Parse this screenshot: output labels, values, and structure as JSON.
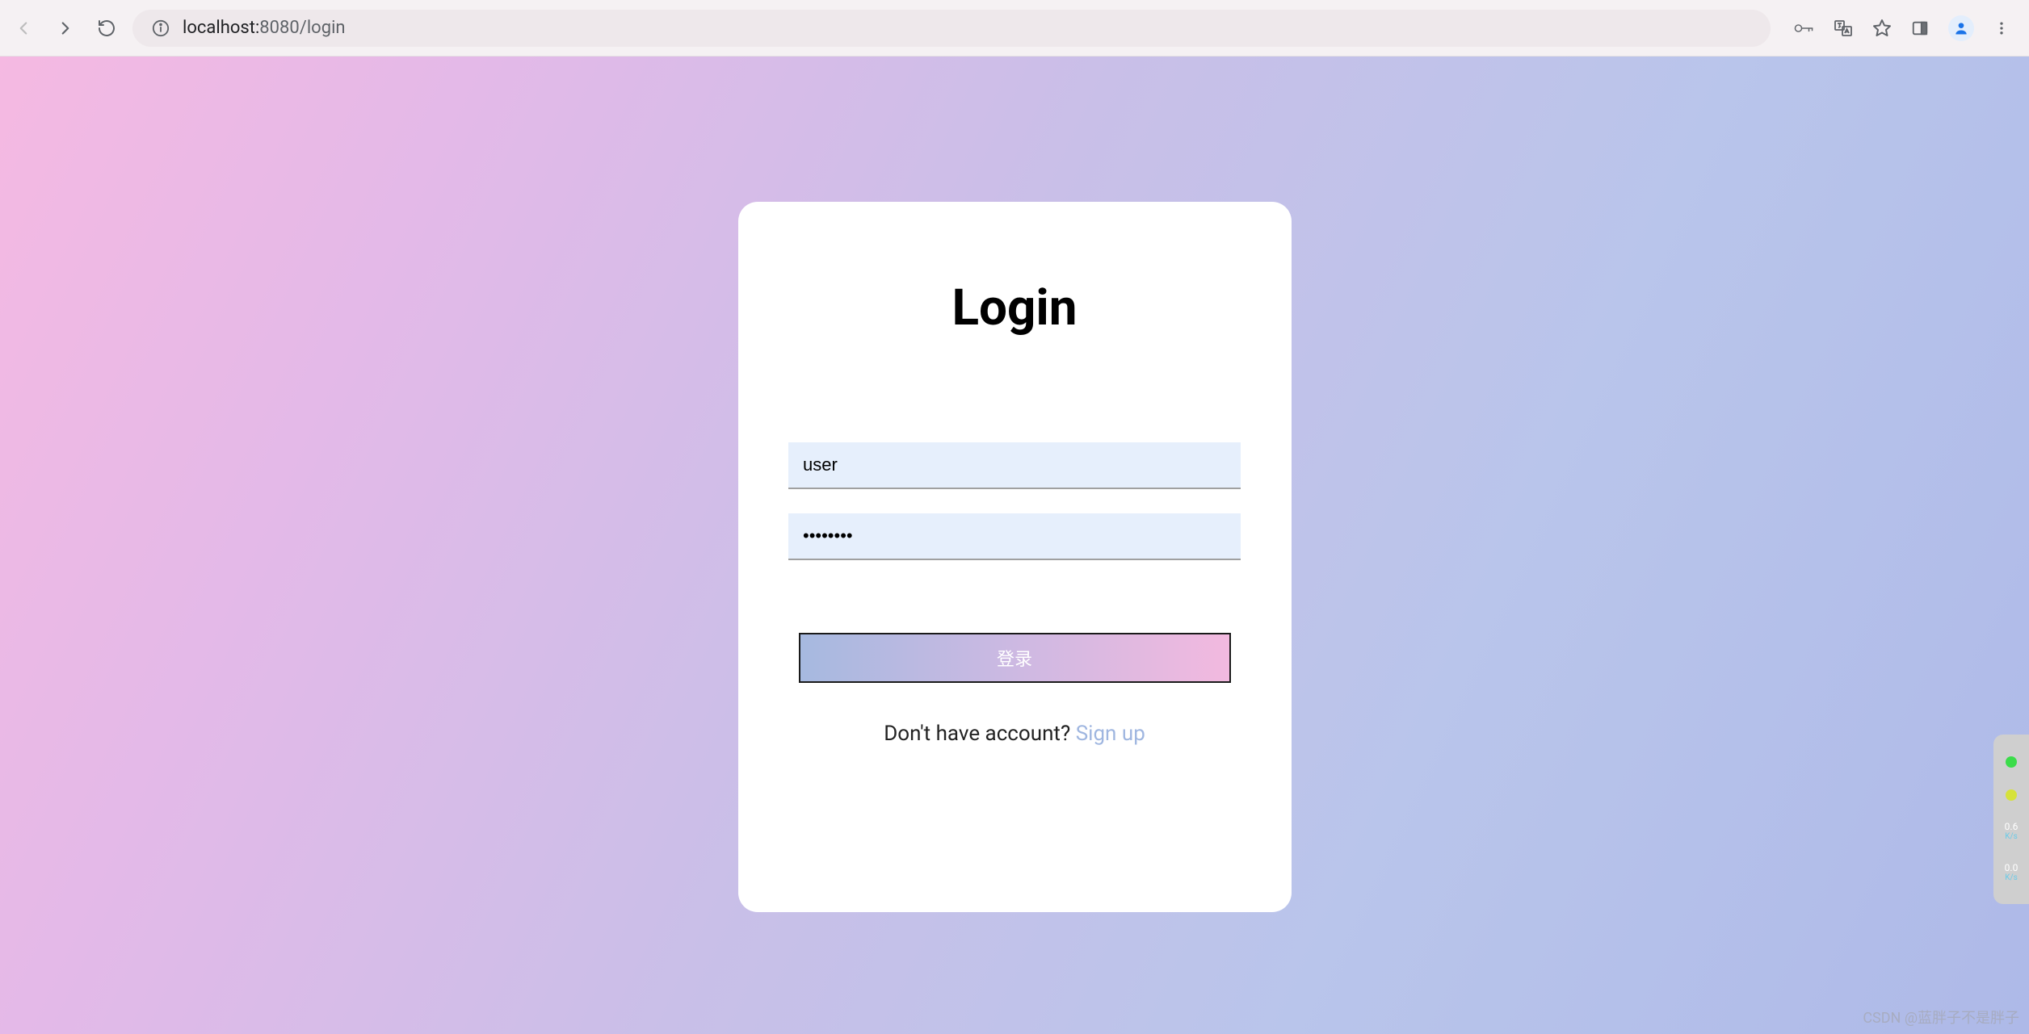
{
  "browser": {
    "url_host": "localhost:",
    "url_port_path": "8080/login"
  },
  "login": {
    "title": "Login",
    "username_value": "user",
    "password_value": "••••••••",
    "submit_label": "登录",
    "signup_prompt": "Don't have account? ",
    "signup_link": "Sign up"
  },
  "widget": {
    "stat1": "0.6",
    "stat1_sub": "K/s",
    "stat2": "0.0",
    "stat2_sub": "K/s"
  },
  "watermark": "CSDN @蓝胖子不是胖子"
}
